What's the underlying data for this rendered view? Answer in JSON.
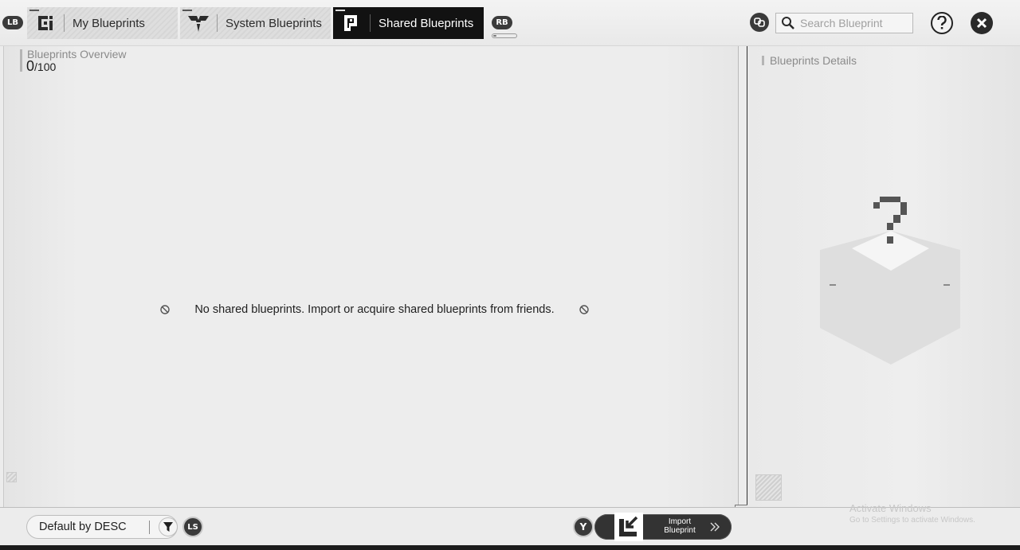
{
  "header": {
    "lb_label": "LB",
    "rb_label": "RB",
    "tabs": [
      {
        "label": "My Blueprints",
        "icon": "my-blueprints-icon",
        "active": false
      },
      {
        "label": "System Blueprints",
        "icon": "endfield-emblem-icon",
        "active": false
      },
      {
        "label": "Shared Blueprints",
        "icon": "shared-blueprints-icon",
        "active": true
      }
    ],
    "search_placeholder": "Search Blueprint"
  },
  "overview": {
    "title": "Blueprints Overview",
    "count": "0",
    "max": "/100",
    "empty_message": "No shared blueprints. Import or acquire shared blueprints from friends."
  },
  "details": {
    "title": "Blueprints Details"
  },
  "footer": {
    "sort_label": "Default by DESC",
    "ls_label": "LS",
    "y_label": "Y",
    "import_line1": "Import",
    "import_line2": "Blueprint"
  },
  "watermark": {
    "line1": "Activate Windows",
    "line2": "Go to Settings to activate Windows."
  },
  "colors": {
    "active_tab": "#121212",
    "panel": "#ededed",
    "accent": "#b5b5b5"
  }
}
